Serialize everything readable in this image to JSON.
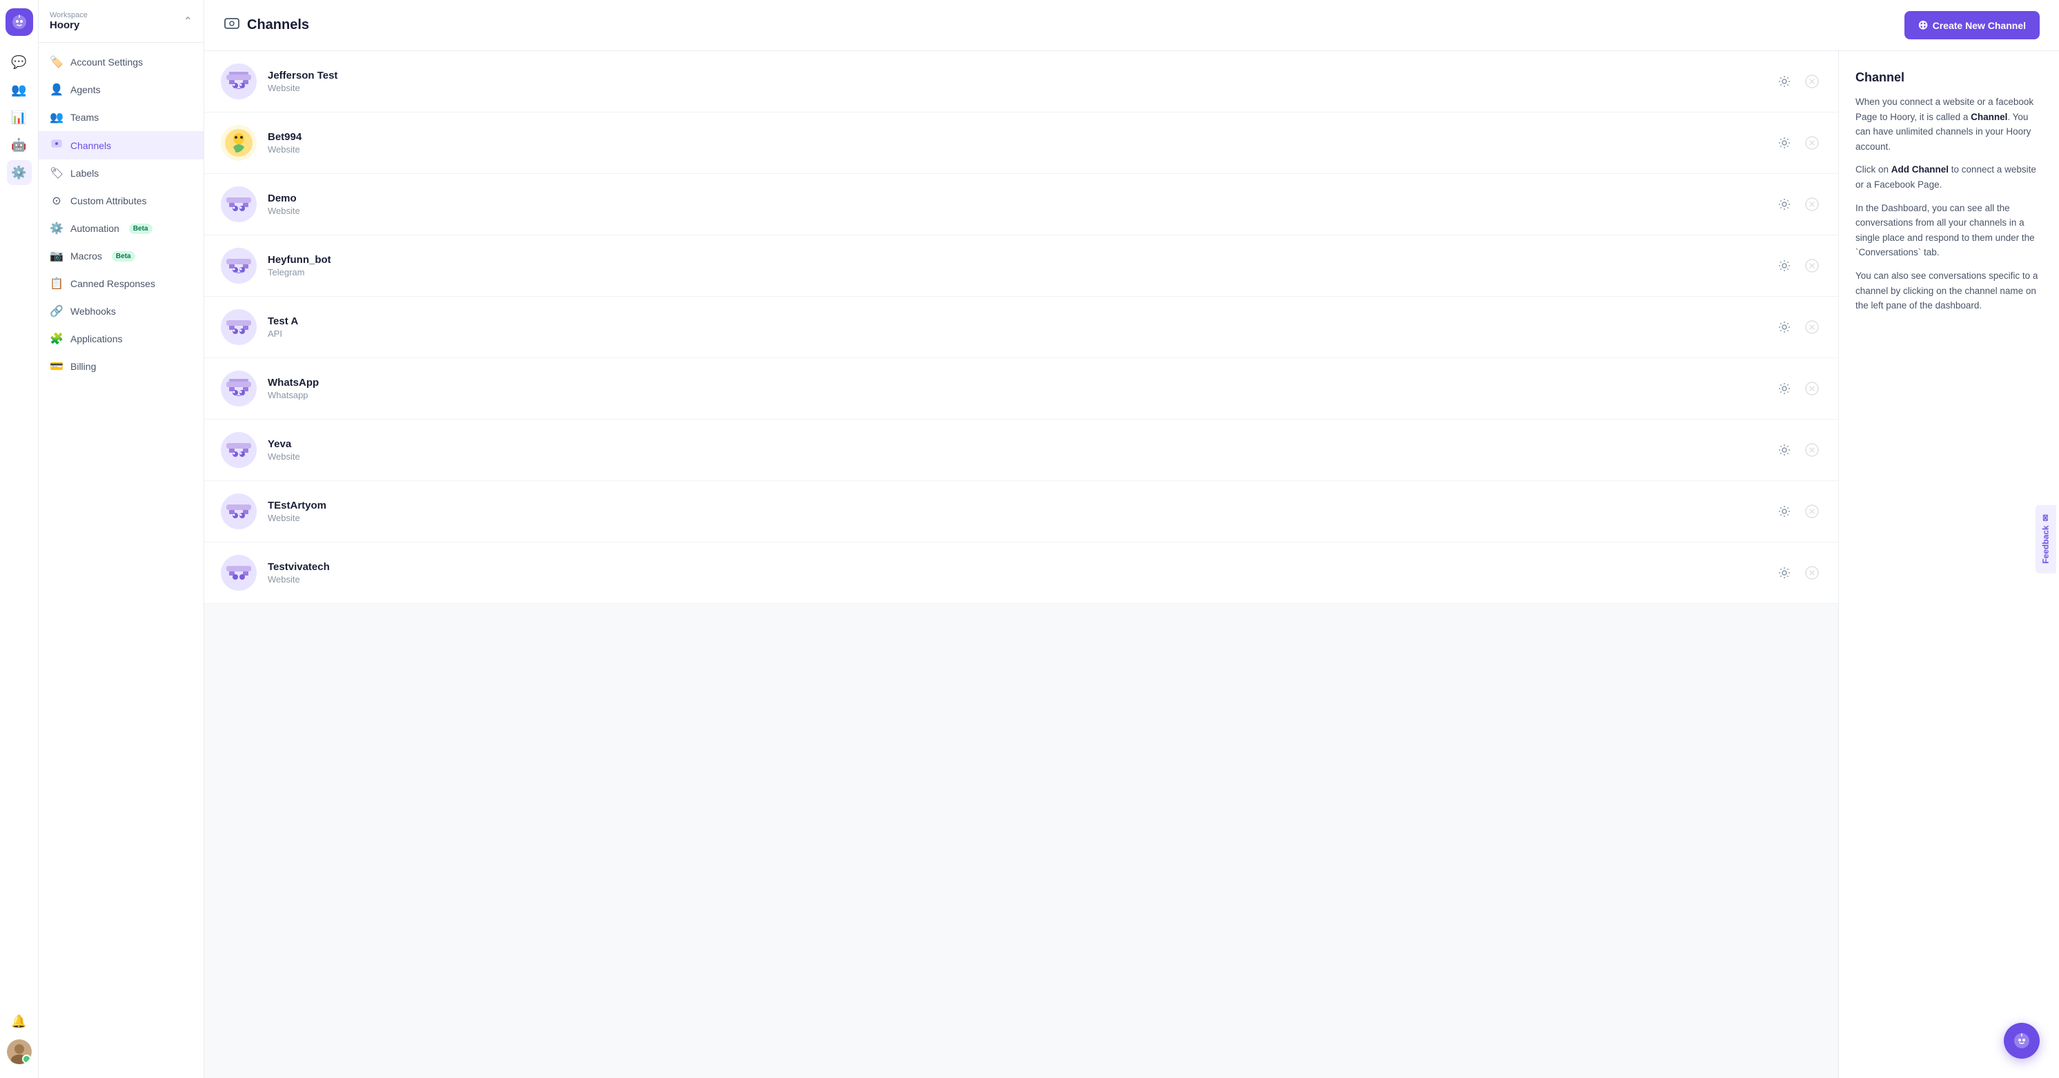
{
  "app": {
    "name": "Hoory"
  },
  "workspace": {
    "label": "Workspace",
    "name": "Hoory",
    "chevron": "⌃"
  },
  "sidebar": {
    "items": [
      {
        "id": "account-settings",
        "label": "Account Settings",
        "icon": "🏷️"
      },
      {
        "id": "agents",
        "label": "Agents",
        "icon": "👤"
      },
      {
        "id": "teams",
        "label": "Teams",
        "icon": "👥"
      },
      {
        "id": "channels",
        "label": "Channels",
        "icon": "📡",
        "active": true
      },
      {
        "id": "labels",
        "label": "Labels",
        "icon": "🏷"
      },
      {
        "id": "custom-attributes",
        "label": "Custom Attributes",
        "icon": "⊙"
      },
      {
        "id": "automation",
        "label": "Automation",
        "icon": "⚙️",
        "badge": "Beta",
        "badge_class": "badge-green"
      },
      {
        "id": "macros",
        "label": "Macros",
        "icon": "📷",
        "badge": "Beta",
        "badge_class": "badge-green"
      },
      {
        "id": "canned-responses",
        "label": "Canned Responses",
        "icon": "📋"
      },
      {
        "id": "webhooks",
        "label": "Webhooks",
        "icon": "🔗"
      },
      {
        "id": "applications",
        "label": "Applications",
        "icon": "🧩"
      },
      {
        "id": "billing",
        "label": "Billing",
        "icon": "💳"
      }
    ]
  },
  "header": {
    "title": "Channels",
    "icon": "📡"
  },
  "create_button": {
    "label": "Create New Channel"
  },
  "channels": [
    {
      "id": 1,
      "name": "Jefferson Test",
      "type": "Website"
    },
    {
      "id": 2,
      "name": "Bet994",
      "type": "Website"
    },
    {
      "id": 3,
      "name": "Demo",
      "type": "Website"
    },
    {
      "id": 4,
      "name": "Heyfunn_bot",
      "type": "Telegram"
    },
    {
      "id": 5,
      "name": "Test A",
      "type": "API"
    },
    {
      "id": 6,
      "name": "WhatsApp",
      "type": "Whatsapp"
    },
    {
      "id": 7,
      "name": "Yeva",
      "type": "Website"
    },
    {
      "id": 8,
      "name": "TEstArtyom",
      "type": "Website"
    },
    {
      "id": 9,
      "name": "Testvivatech",
      "type": "Website"
    }
  ],
  "info_panel": {
    "title": "Channel",
    "paragraphs": [
      "When you connect a website or a facebook Page to Hoory, it is called a **Channel**. You can have unlimited channels in your Hoory account.",
      "Click on **Add Channel** to connect a website or a Facebook Page.",
      "In the Dashboard, you can see all the conversations from all your channels in a single place and respond to them under the `Conversations` tab.",
      "You can also see conversations specific to a channel by clicking on the channel name on the left pane of the dashboard."
    ]
  },
  "feedback": {
    "label": "Feedback"
  },
  "nav_icons": [
    {
      "id": "chat",
      "icon": "💬"
    },
    {
      "id": "contacts",
      "icon": "👥"
    },
    {
      "id": "reports",
      "icon": "📊"
    },
    {
      "id": "notifications",
      "icon": "🔔"
    },
    {
      "id": "settings",
      "icon": "⚙️",
      "active": true
    }
  ]
}
